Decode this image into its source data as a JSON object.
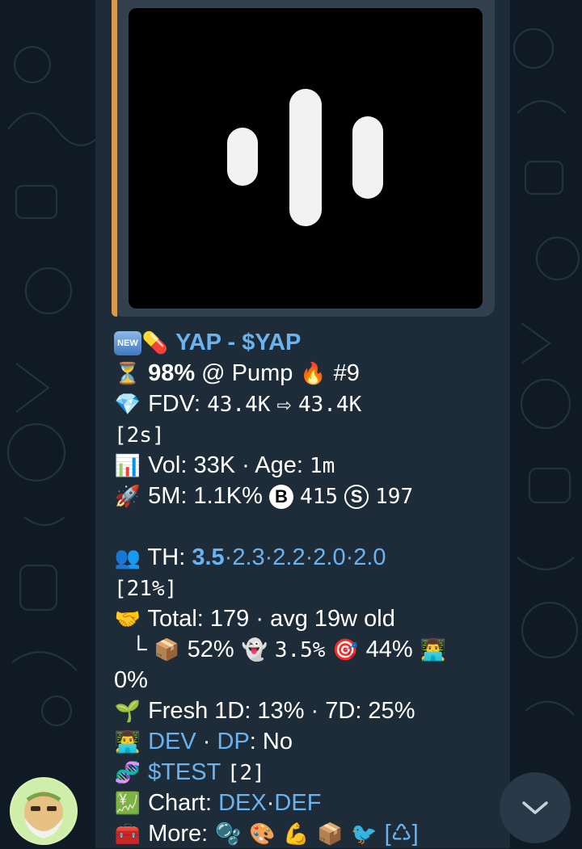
{
  "token": {
    "name_line": "YAP - $YAP",
    "pump_pct": "98%",
    "pump_text": "@ Pump",
    "rank": "#9",
    "fdv_label": "FDV:",
    "fdv_from": "43.4K",
    "fdv_arrow": "⇨",
    "fdv_to": "43.4K",
    "fdv_age": "[2s]",
    "vol_text": "Vol: 33K · Age:",
    "age_val": "1m",
    "m5_label": "5M:",
    "m5_val": "1.1K%",
    "buys": "415",
    "sells": "197",
    "th_label": "TH:",
    "th_first": "3.5",
    "th_rest": "·2.3·2.2·2.0·2.0",
    "th_pct": "[21%]",
    "total_text": "Total: 179 · avg",
    "total_age": "19w",
    "total_old": "old",
    "corner": "└",
    "box_pct": "52%",
    "ghost_pct": "3.5%",
    "target_pct": "44%",
    "dev_pct": "0%",
    "fresh_text": "Fresh 1D: 13% · 7D: 25%",
    "dev_label": "DEV",
    "dp_label": "DP",
    "dp_val": ": No",
    "test_link": "$TEST",
    "test_count": "[2]",
    "chart_label": "Chart:",
    "chart_dex": "DEX",
    "chart_def": "DEF",
    "more_label": "More:",
    "more_end": "[♺]"
  },
  "icons": {
    "new": "NEW",
    "pill": "💊",
    "hourglass": "⏳",
    "fire": "🔥",
    "diamond": "💎",
    "bar_chart": "📊",
    "rocket": "🚀",
    "buy_badge": "B",
    "sell_badge": "S",
    "people": "👥",
    "handshake": "🤝",
    "box": "📦",
    "ghost": "👻",
    "target": "🎯",
    "technologist": "👨‍💻",
    "seedling": "🌱",
    "dna": "🧬",
    "yen_chart": "💹",
    "toolbox": "🧰",
    "bubbles": "🫧",
    "palette": "🎨",
    "muscle": "💪",
    "bird": "🐦"
  },
  "colors": {
    "link": "#69b4f0",
    "accent": "#d79a4e",
    "bubble": "#1e2c3a"
  }
}
